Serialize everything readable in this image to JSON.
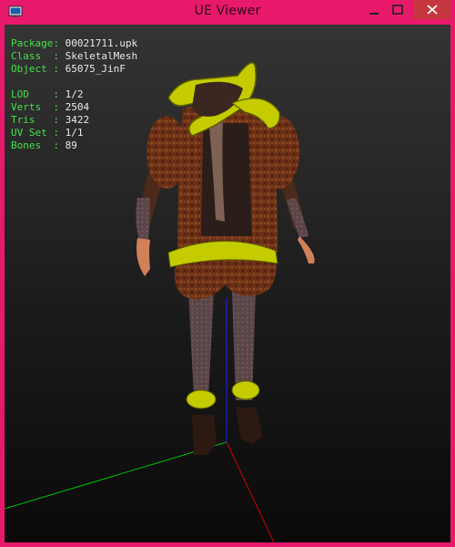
{
  "window": {
    "title": "UE Viewer",
    "accent_color": "#e8196a",
    "icons": {
      "app": "monitor-icon",
      "minimize": "minimize-icon",
      "maximize": "maximize-icon",
      "close": "close-icon"
    }
  },
  "info": {
    "package": {
      "label": "Package:",
      "value": "00021711.upk"
    },
    "class": {
      "label": "Class  :",
      "value": "SkeletalMesh"
    },
    "object": {
      "label": "Object :",
      "value": "65075_JinF"
    },
    "lod": {
      "label": "LOD    :",
      "value": "1/2"
    },
    "verts": {
      "label": "Verts  :",
      "value": "2504"
    },
    "tris": {
      "label": "Tris   :",
      "value": "3422"
    },
    "uvset": {
      "label": "UV Set :",
      "value": "1/1"
    },
    "bones": {
      "label": "Bones  :",
      "value": "89"
    }
  },
  "viewport": {
    "background": "#1c1c1c",
    "axis_colors": {
      "x": "#00c000",
      "y": "#d00000",
      "z": "#2020ff"
    }
  }
}
